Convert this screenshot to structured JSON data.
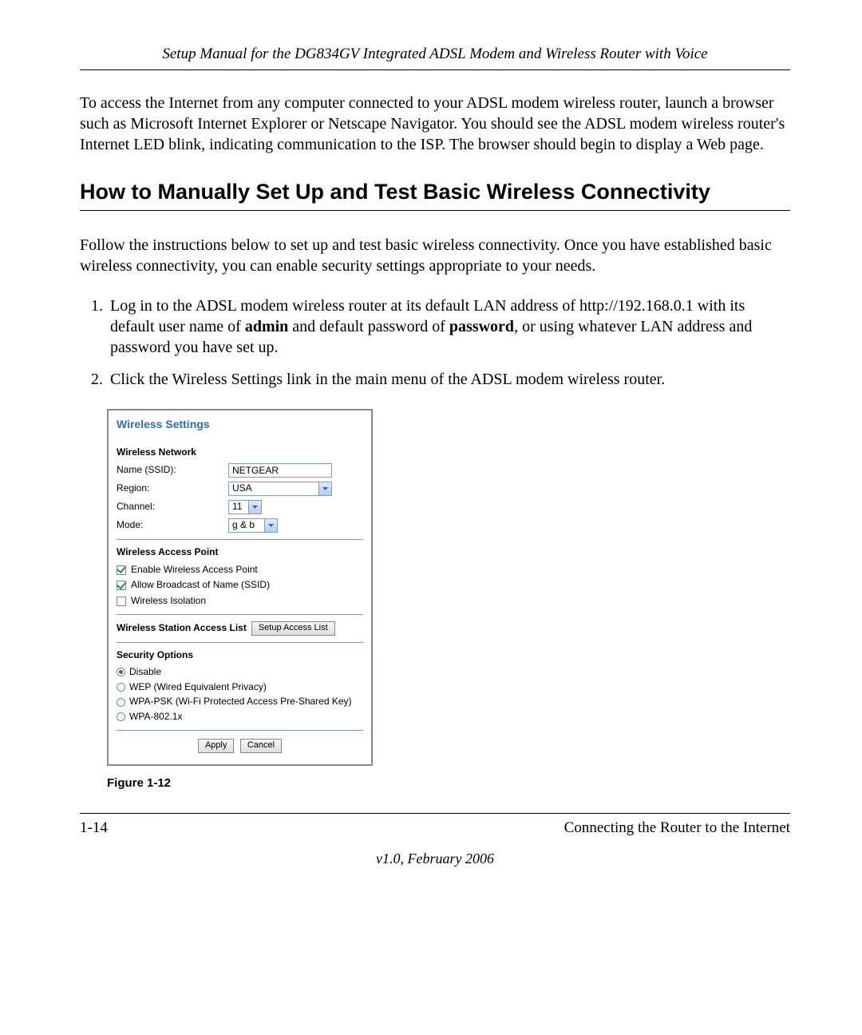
{
  "header": "Setup Manual for the DG834GV Integrated ADSL Modem and Wireless Router with Voice",
  "intro_para": "To access the Internet from any computer connected to your ADSL modem wireless router, launch a browser such as Microsoft Internet Explorer or Netscape Navigator. You should see the ADSL modem wireless router's Internet LED blink, indicating communication to the ISP. The browser should begin to display a Web page.",
  "heading": "How to Manually Set Up and Test Basic Wireless Connectivity",
  "follow_para": "Follow the instructions below to set up and test basic wireless connectivity. Once you have established basic wireless connectivity, you can enable security settings appropriate to your needs.",
  "step1_a": "Log in to the ADSL modem wireless router at its default LAN address of http://192.168.0.1 with its default user name of ",
  "step1_admin": "admin",
  "step1_b": " and default password of ",
  "step1_password": "password",
  "step1_c": ", or using whatever LAN address and password you have set up.",
  "step2": "Click the Wireless Settings link in the main menu of the ADSL modem wireless router.",
  "panel": {
    "title": "Wireless Settings",
    "wn_label": "Wireless Network",
    "name_label": "Name (SSID):",
    "name_value": "NETGEAR",
    "region_label": "Region:",
    "region_value": "USA",
    "channel_label": "Channel:",
    "channel_value": "11",
    "mode_label": "Mode:",
    "mode_value": "g & b",
    "wap_label": "Wireless Access Point",
    "chk1": "Enable Wireless Access Point",
    "chk2": "Allow Broadcast of Name (SSID)",
    "chk3": "Wireless Isolation",
    "access_list_label": "Wireless Station Access List",
    "access_btn": "Setup Access List",
    "sec_label": "Security Options",
    "opt1": "Disable",
    "opt2": "WEP (Wired Equivalent Privacy)",
    "opt3": "WPA-PSK (Wi-Fi Protected Access Pre-Shared Key)",
    "opt4": "WPA-802.1x",
    "apply": "Apply",
    "cancel": "Cancel"
  },
  "figure_caption": "Figure 1-12",
  "footer_left": "1-14",
  "footer_right": "Connecting the Router to the Internet",
  "footer_center": "v1.0, February 2006"
}
